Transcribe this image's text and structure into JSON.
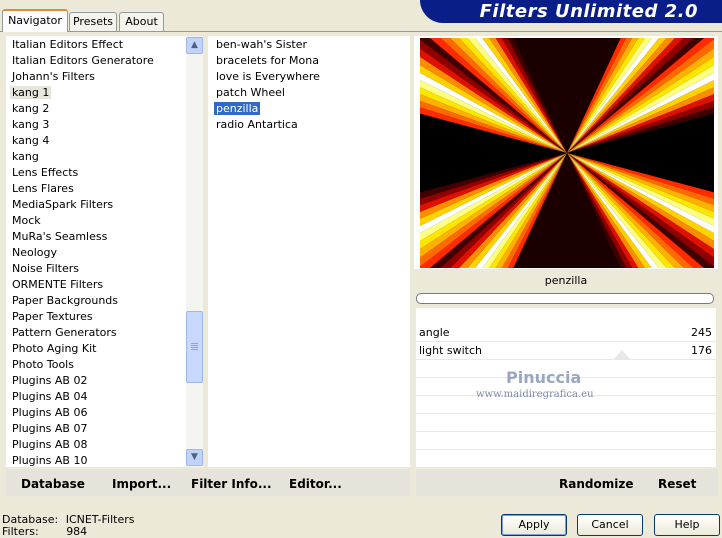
{
  "tabs": [
    {
      "label": "Navigator",
      "active": true
    },
    {
      "label": "Presets",
      "active": false
    },
    {
      "label": "About",
      "active": false
    }
  ],
  "banner_title": "Filters Unlimited 2.0",
  "categories": [
    "Italian Editors Effect",
    "Italian Editors Generatore",
    "Johann's Filters",
    "kang 1",
    "kang 2",
    "kang 3",
    "kang 4",
    "kang",
    "Lens Effects",
    "Lens Flares",
    "MediaSpark Filters",
    "Mock",
    "MuRa's Seamless",
    "Neology",
    "Noise Filters",
    "ORMENTE Filters",
    "Paper Backgrounds",
    "Paper Textures",
    "Pattern Generators",
    "Photo Aging Kit",
    "Photo Tools",
    "Plugins AB 02",
    "Plugins AB 04",
    "Plugins AB 06",
    "Plugins AB 07",
    "Plugins AB 08",
    "Plugins AB 10"
  ],
  "selected_category": "kang 1",
  "filters": [
    "ben-wah's Sister",
    "bracelets for Mona",
    "love is Everywhere",
    "patch Wheel",
    "penzilla",
    "radio Antartica"
  ],
  "selected_filter": "penzilla",
  "preview": {
    "filter_name": "penzilla",
    "progress": 0
  },
  "params": [
    {
      "label": "angle",
      "value": "245"
    },
    {
      "label": "light switch",
      "value": "176"
    }
  ],
  "watermark": {
    "line1": "Pinuccia",
    "line2": "www.maidiregrafica.eu"
  },
  "bottom_links": {
    "database": "Database",
    "import": "Import...",
    "filter_info": "Filter Info...",
    "editor": "Editor...",
    "randomize": "Randomize",
    "reset": "Reset"
  },
  "status": {
    "database_label": "Database:",
    "database_value": "ICNET-Filters",
    "filters_label": "Filters:",
    "filters_value": "984"
  },
  "buttons": {
    "apply": "Apply",
    "cancel": "Cancel",
    "help": "Help"
  },
  "colors": {
    "selection": "#316ac5",
    "banner": "#0a1e8a",
    "tab_accent": "#e68b2c"
  },
  "icons": [
    "scroll-up-icon",
    "scroll-down-icon",
    "scroll-grip-icon"
  ]
}
